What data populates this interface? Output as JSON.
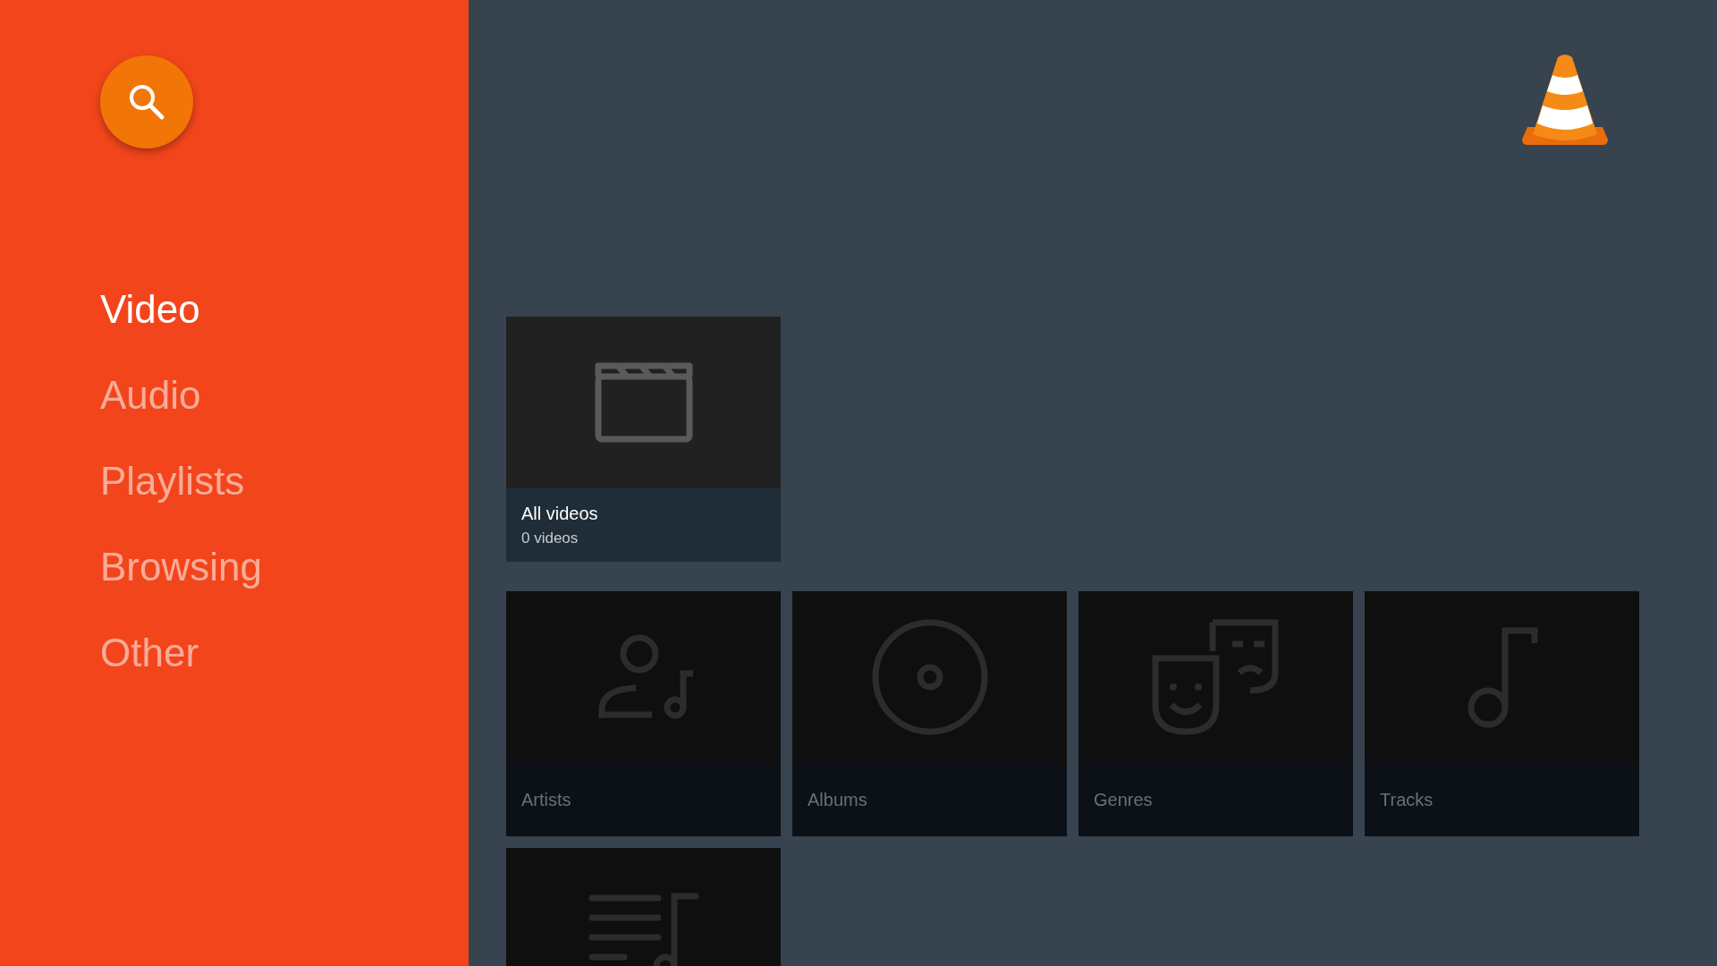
{
  "sidebar": {
    "items": [
      {
        "label": "Video",
        "selected": true
      },
      {
        "label": "Audio",
        "selected": false
      },
      {
        "label": "Playlists",
        "selected": false
      },
      {
        "label": "Browsing",
        "selected": false
      },
      {
        "label": "Other",
        "selected": false
      }
    ]
  },
  "rows": [
    {
      "focused": true,
      "cards": [
        {
          "kind": "video",
          "title": "All videos",
          "subtitle": "0 videos"
        }
      ]
    },
    {
      "focused": false,
      "cards": [
        {
          "kind": "artists",
          "title": "Artists"
        },
        {
          "kind": "albums",
          "title": "Albums"
        },
        {
          "kind": "genres",
          "title": "Genres"
        },
        {
          "kind": "tracks",
          "title": "Tracks"
        }
      ]
    },
    {
      "focused": false,
      "cards": [
        {
          "kind": "playlist"
        }
      ]
    }
  ]
}
